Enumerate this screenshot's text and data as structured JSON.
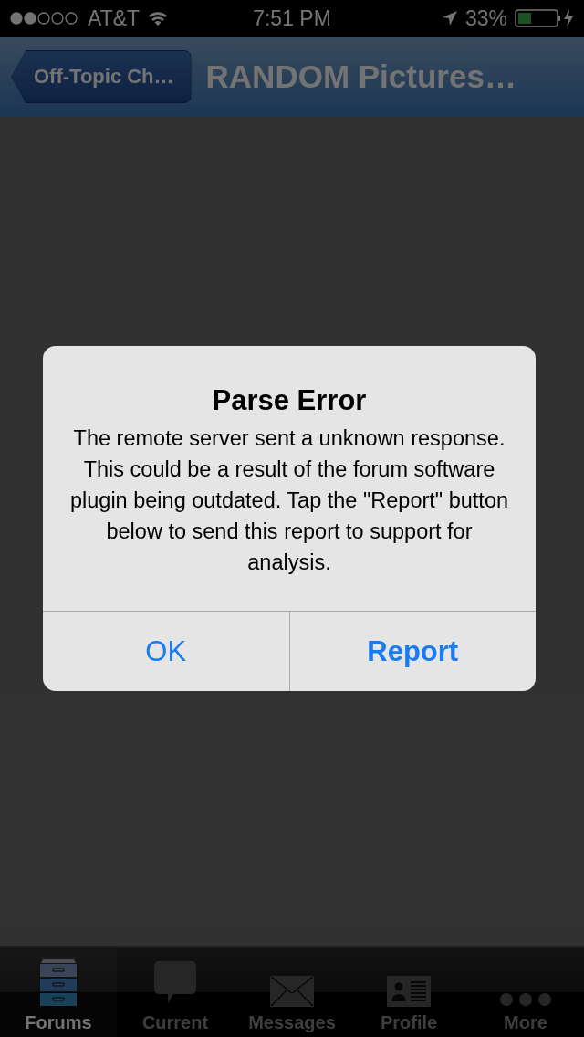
{
  "status_bar": {
    "carrier": "AT&T",
    "time": "7:51 PM",
    "battery": "33%"
  },
  "nav_bar": {
    "back": "Off-Topic Ch…",
    "title": "RANDOM Pictures…"
  },
  "alert": {
    "title": "Parse Error",
    "message": "The remote server sent a unknown response.  This could be a result of the forum software plugin being outdated. Tap the \"Report\" button below to send this report to support for analysis.",
    "buttons": [
      {
        "label": "OK",
        "kind": "cancel"
      },
      {
        "label": "Report",
        "kind": "default"
      }
    ]
  },
  "tab_bar": [
    {
      "label": "Forums",
      "kind": "cabinet",
      "selected": true
    },
    {
      "label": "Current",
      "kind": "bubble",
      "selected": false
    },
    {
      "label": "Messages",
      "kind": "envelope",
      "selected": false
    },
    {
      "label": "Profile",
      "kind": "card",
      "selected": false
    },
    {
      "label": "More",
      "kind": "dots",
      "selected": false
    }
  ]
}
